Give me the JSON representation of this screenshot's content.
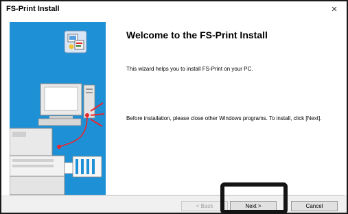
{
  "window": {
    "title": "FS-Print Install",
    "close_glyph": "×"
  },
  "content": {
    "heading": "Welcome to the FS-Print Install",
    "intro": "This wizard helps you to install FS-Print on your PC.",
    "instructions": "Before installation, please close other Windows programs. To install, click [Next]."
  },
  "buttons": {
    "back": "< Back",
    "next": "Next >",
    "cancel": "Cancel"
  },
  "banner": {
    "background_color": "#1e91d6",
    "icons": [
      "installer-icon",
      "computer-icon",
      "printer-icon"
    ]
  },
  "colors": {
    "window_bg": "#f0f0f0",
    "accent_red": "#e8262d"
  }
}
